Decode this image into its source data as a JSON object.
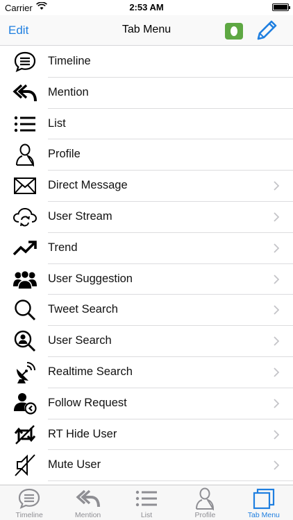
{
  "status_bar": {
    "carrier": "Carrier",
    "time": "2:53 AM"
  },
  "nav_bar": {
    "edit_label": "Edit",
    "title": "Tab Menu",
    "accent_color": "#1f7fe0",
    "evernote_color": "#5ea843"
  },
  "menu": {
    "items": [
      {
        "label": "Timeline",
        "icon": "speech-bubble-icon",
        "chevron": false
      },
      {
        "label": "Mention",
        "icon": "reply-all-icon",
        "chevron": false
      },
      {
        "label": "List",
        "icon": "list-icon",
        "chevron": false
      },
      {
        "label": "Profile",
        "icon": "person-icon",
        "chevron": false
      },
      {
        "label": "Direct Message",
        "icon": "envelope-icon",
        "chevron": true
      },
      {
        "label": "User Stream",
        "icon": "cloud-sync-icon",
        "chevron": true
      },
      {
        "label": "Trend",
        "icon": "trend-up-icon",
        "chevron": true
      },
      {
        "label": "User Suggestion",
        "icon": "group-icon",
        "chevron": true
      },
      {
        "label": "Tweet Search",
        "icon": "magnifier-icon",
        "chevron": true
      },
      {
        "label": "User Search",
        "icon": "user-search-icon",
        "chevron": true
      },
      {
        "label": "Realtime Search",
        "icon": "satellite-dish-icon",
        "chevron": true
      },
      {
        "label": "Follow Request",
        "icon": "follow-request-icon",
        "chevron": true
      },
      {
        "label": "RT Hide User",
        "icon": "retweet-hide-icon",
        "chevron": true
      },
      {
        "label": "Mute User",
        "icon": "mute-icon",
        "chevron": true
      }
    ]
  },
  "tab_bar": {
    "tabs": [
      {
        "label": "Timeline",
        "icon": "speech-bubble-icon",
        "active": false
      },
      {
        "label": "Mention",
        "icon": "reply-all-icon",
        "active": false
      },
      {
        "label": "List",
        "icon": "list-icon",
        "active": false
      },
      {
        "label": "Profile",
        "icon": "person-icon",
        "active": false
      },
      {
        "label": "Tab Menu",
        "icon": "stacked-windows-icon",
        "active": true
      }
    ]
  }
}
